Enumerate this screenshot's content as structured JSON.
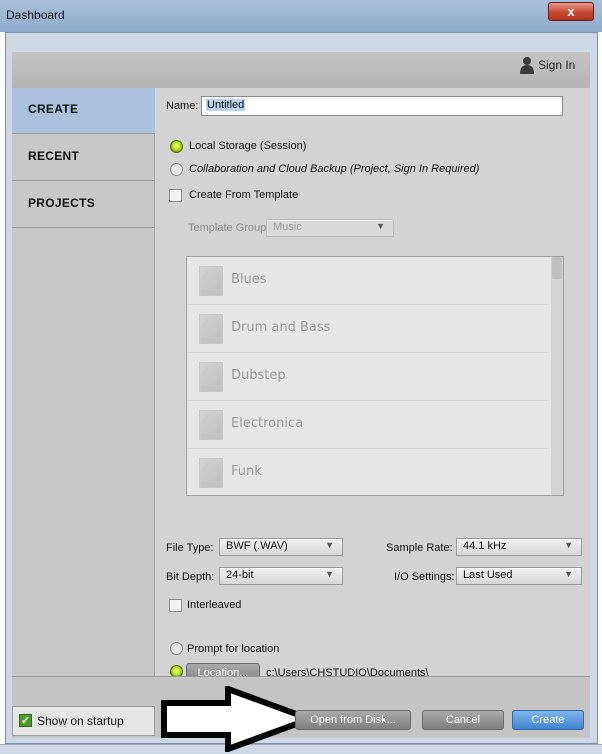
{
  "window": {
    "title": "Dashboard",
    "close_label": "x"
  },
  "header": {
    "sign_in_label": "Sign In"
  },
  "sidebar": {
    "items": [
      {
        "label": "CREATE",
        "active": true
      },
      {
        "label": "RECENT",
        "active": false
      },
      {
        "label": "PROJECTS",
        "active": false
      }
    ]
  },
  "create": {
    "name_label": "Name:",
    "name_value": "Untitled",
    "storage_local_label": "Local Storage (Session)",
    "storage_cloud_label": "Collaboration and Cloud Backup (Project, Sign In Required)",
    "from_template_label": "Create From Template",
    "template_group_label": "Template Group:",
    "template_group_value": "Music",
    "templates": [
      "Blues",
      "Drum and Bass",
      "Dubstep",
      "Electronica",
      "Funk"
    ],
    "template_icon_tag": "TEMPLATE",
    "file_type_label": "File Type:",
    "file_type_value": "BWF (.WAV)",
    "sample_rate_label": "Sample Rate:",
    "sample_rate_value": "44.1 kHz",
    "bit_depth_label": "Bit Depth:",
    "bit_depth_value": "24-bit",
    "io_settings_label": "I/O Settings:",
    "io_settings_value": "Last Used",
    "interleaved_label": "Interleaved",
    "prompt_location_label": "Prompt for location",
    "location_button_label": "Location...",
    "location_path": "c:\\Users\\CHSTUDIO\\Documents\\"
  },
  "footer": {
    "show_on_startup_label": "Show on startup",
    "open_from_disk_label": "Open from Disk...",
    "cancel_label": "Cancel",
    "create_label": "Create"
  },
  "colors": {
    "accent_blue": "#3f84cf",
    "radio_selected": "#c7ea24",
    "sidebar_active": "#a9c1dd"
  }
}
